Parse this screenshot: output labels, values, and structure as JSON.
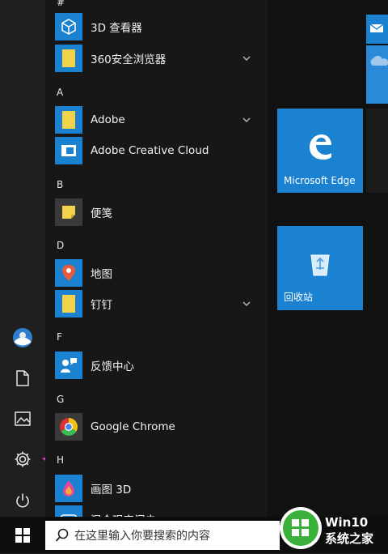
{
  "top_letter": "#",
  "sections": [
    "A",
    "B",
    "D",
    "F",
    "G",
    "H"
  ],
  "apps": {
    "item_3d": "3D 查看器",
    "item_360": "360安全浏览器",
    "item_adobe": "Adobe",
    "item_adobe_cc": "Adobe Creative Cloud",
    "item_notes": "便笺",
    "item_maps": "地图",
    "item_dingding": "钉钉",
    "item_feedback": "反馈中心",
    "item_chrome": "Google Chrome",
    "item_paint3d": "画图 3D",
    "item_mixed": "混合现实门户"
  },
  "tiles": {
    "edge": "Microsoft Edge",
    "recycle": "回收站"
  },
  "search": {
    "placeholder": "在这里输入你要搜索的内容"
  },
  "watermark": {
    "line1": "Win10",
    "line2": "系统之家"
  },
  "colors": {
    "accent": "#1b82d2",
    "folder": "#f2d24b",
    "arrow": "#d63fd6"
  },
  "icons": [
    "user-avatar-icon",
    "document-icon",
    "picture-icon",
    "settings-gear-icon",
    "power-icon",
    "windows-start-icon",
    "search-icon"
  ]
}
